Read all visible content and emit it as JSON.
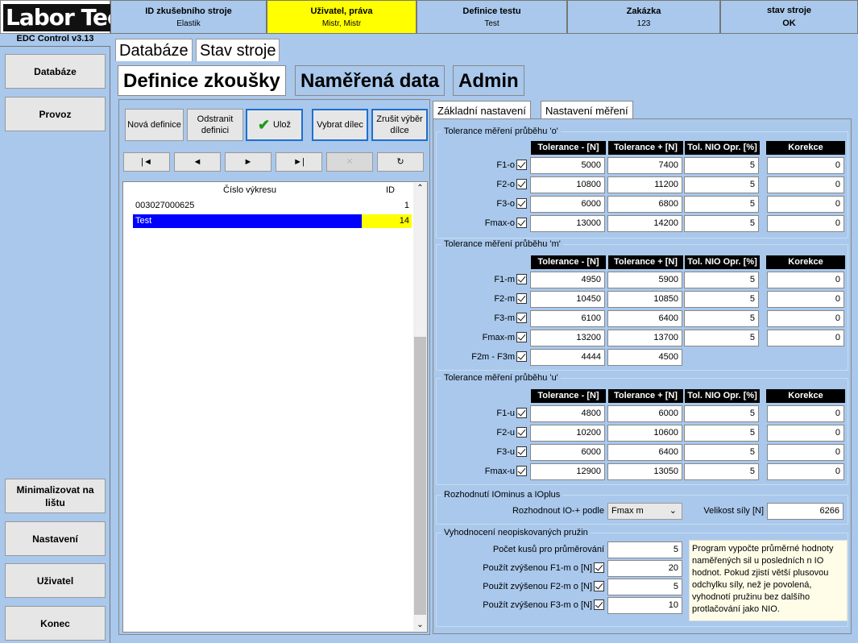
{
  "logo": {
    "left": "Labor",
    "right": "Tech"
  },
  "header": {
    "cells": [
      {
        "title": "ID zkušebního stroje",
        "value": "Elastik"
      },
      {
        "title": "Uživatel, práva",
        "value": "Mistr, Mistr"
      },
      {
        "title": "Definice testu",
        "value": "Test"
      },
      {
        "title": "Zakázka",
        "value": "123"
      },
      {
        "title": "stav stroje",
        "value": "OK"
      }
    ]
  },
  "version": "EDC Control v3.13",
  "sidebar": {
    "items": [
      "Databáze",
      "Provoz",
      "Minimalizovat na lištu",
      "Nastavení",
      "Uživatel",
      "Konec"
    ]
  },
  "tabs": {
    "top": [
      "Databáze",
      "Stav stroje"
    ],
    "sub": [
      "Definice zkoušky",
      "Naměřená data",
      "Admin"
    ]
  },
  "toolbar": {
    "new": "Nová definice",
    "remove": "Odstranit definici",
    "save": "Ulož",
    "select_part": "Vybrat dílec",
    "cancel_part": "Zrušit výběr dílce"
  },
  "nav": {
    "first": "|◄",
    "prev": "◄",
    "next": "►",
    "last": "►|",
    "delete": "✕",
    "refresh": "↻"
  },
  "list": {
    "headers": [
      "Číslo výkresu",
      "ID"
    ],
    "rows": [
      {
        "name": "003027000625",
        "id": "1"
      },
      {
        "name": "Test",
        "id": "14"
      }
    ]
  },
  "right_tabs": [
    "Základní nastavení",
    "Nastavení měření"
  ],
  "columns": [
    "Tolerance - [N]",
    "Tolerance + [N]",
    "Tol. NIO Opr. [%]",
    "Korekce"
  ],
  "groups": {
    "o": {
      "title": "Tolerance měření průběhu 'o'",
      "rows": [
        {
          "label": "F1-o",
          "minus": "5000",
          "plus": "7400",
          "nio": "5",
          "kor": "0"
        },
        {
          "label": "F2-o",
          "minus": "10800",
          "plus": "11200",
          "nio": "5",
          "kor": "0"
        },
        {
          "label": "F3-o",
          "minus": "6000",
          "plus": "6800",
          "nio": "5",
          "kor": "0"
        },
        {
          "label": "Fmax-o",
          "minus": "13000",
          "plus": "14200",
          "nio": "5",
          "kor": "0"
        }
      ]
    },
    "m": {
      "title": "Tolerance měření průběhu 'm'",
      "rows": [
        {
          "label": "F1-m",
          "minus": "4950",
          "plus": "5900",
          "nio": "5",
          "kor": "0"
        },
        {
          "label": "F2-m",
          "minus": "10450",
          "plus": "10850",
          "nio": "5",
          "kor": "0"
        },
        {
          "label": "F3-m",
          "minus": "6100",
          "plus": "6400",
          "nio": "5",
          "kor": "0"
        },
        {
          "label": "Fmax-m",
          "minus": "13200",
          "plus": "13700",
          "nio": "5",
          "kor": "0"
        }
      ],
      "extra": {
        "label": "F2m - F3m",
        "minus": "4444",
        "plus": "4500"
      }
    },
    "u": {
      "title": "Tolerance měření průběhu 'u'",
      "rows": [
        {
          "label": "F1-u",
          "minus": "4800",
          "plus": "6000",
          "nio": "5",
          "kor": "0"
        },
        {
          "label": "F2-u",
          "minus": "10200",
          "plus": "10600",
          "nio": "5",
          "kor": "0"
        },
        {
          "label": "F3-u",
          "minus": "6000",
          "plus": "6400",
          "nio": "5",
          "kor": "0"
        },
        {
          "label": "Fmax-u",
          "minus": "12900",
          "plus": "13050",
          "nio": "5",
          "kor": "0"
        }
      ]
    }
  },
  "decision": {
    "title": "Rozhodnutí IOminus a IOplus",
    "label": "Rozhodnout IO-+ podle",
    "select": "Fmax m",
    "force_label": "Velikost síly [N]",
    "force_value": "6266"
  },
  "springs": {
    "title": "Vyhodnocení neopiskovaných pružin",
    "rows": [
      {
        "label": "Počet kusů pro průměrování",
        "value": "5",
        "check": false
      },
      {
        "label": "Použít zvýšenou F1-m o [N]",
        "value": "20",
        "check": true
      },
      {
        "label": "Použít zvýšenou F2-m o [N]",
        "value": "5",
        "check": true
      },
      {
        "label": "Použít zvýšenou F3-m o [N]",
        "value": "10",
        "check": true
      }
    ],
    "note": "Program vypočte průměrné hodnoty naměřených sil u posledních n IO hodnot. Pokud zjistí větší plusovou odchylku síly, než je povolená, vyhodnotí pružinu bez dalšího protlačování jako NIO."
  },
  "colors": {
    "background": "#a9c8ec",
    "highlight_row": "#0000ff",
    "highlight_id": "#ffff00",
    "header_yellow": "#ffff00"
  }
}
